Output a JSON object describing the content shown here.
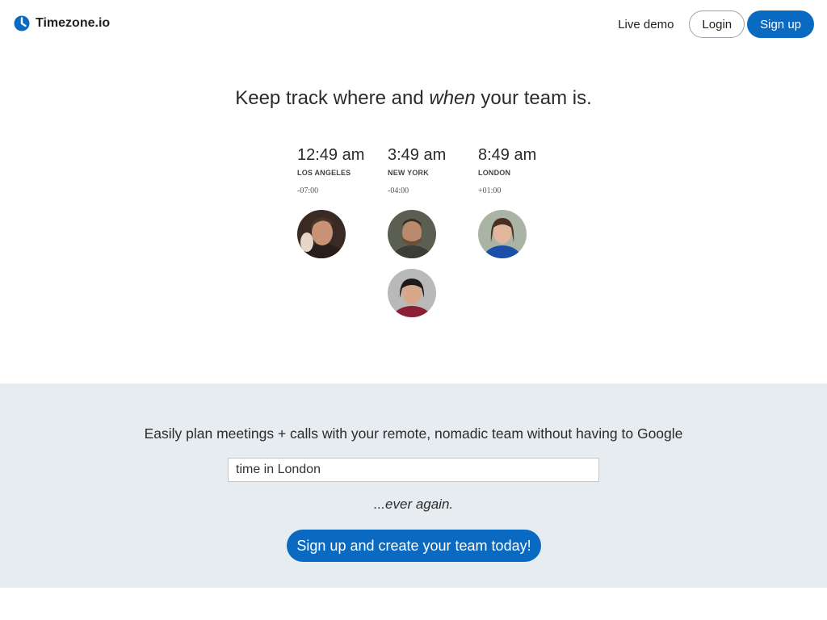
{
  "brand": {
    "name": "Timezone.io",
    "icon": "clock-icon",
    "color": "#0a6ac1"
  },
  "nav": {
    "live_demo": "Live demo",
    "login": "Login",
    "signup": "Sign up"
  },
  "hero": {
    "title_before": "Keep track where and ",
    "title_em": "when",
    "title_after": " your team is."
  },
  "zones": [
    {
      "time": "12:49 am",
      "city": "LOS ANGELES",
      "offset": "-07:00",
      "members": 1
    },
    {
      "time": "3:49 am",
      "city": "NEW YORK",
      "offset": "-04:00",
      "members": 2
    },
    {
      "time": "8:49 am",
      "city": "LONDON",
      "offset": "+01:00",
      "members": 1
    }
  ],
  "cta": {
    "text": "Easily plan meetings + calls with your remote, nomadic team without having to Google",
    "input_value": "time in London",
    "ever_again": "...ever again.",
    "button": "Sign up and create your team today!"
  },
  "colors": {
    "accent": "#0a6ac1",
    "cta_background": "#e7ecf0"
  }
}
